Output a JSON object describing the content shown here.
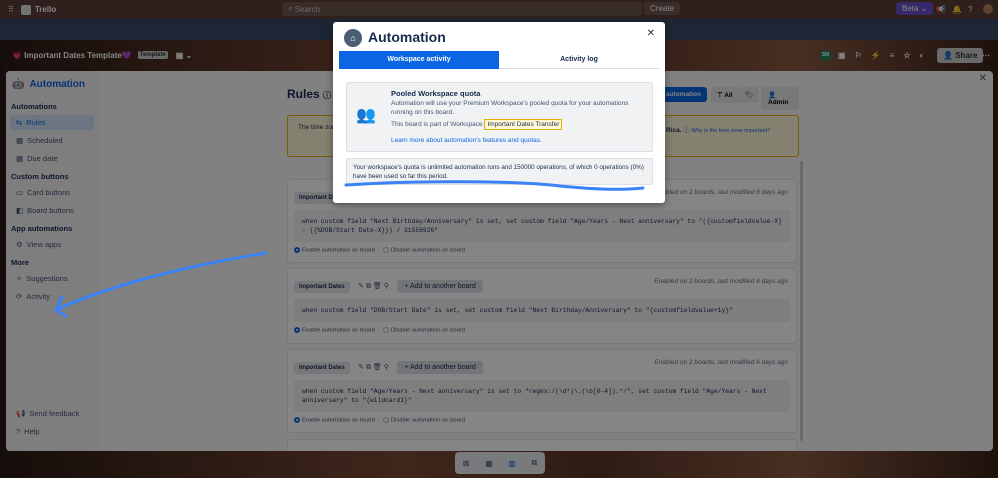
{
  "topbar": {
    "app_name": "Trello",
    "search_placeholder": "Search",
    "create_label": "Create",
    "beta_label": "Beta"
  },
  "board": {
    "title": "💗 Important Dates Template💜",
    "template_badge": "Template",
    "member_initials": "SM",
    "share_label": "Share"
  },
  "automation_panel": {
    "title": "Automation",
    "sidebar": {
      "sections": [
        {
          "heading": "Automations",
          "items": [
            "Rules",
            "Scheduled",
            "Due date"
          ]
        },
        {
          "heading": "Custom buttons",
          "items": [
            "Card buttons",
            "Board buttons"
          ]
        },
        {
          "heading": "App automations",
          "items": [
            "View apps"
          ]
        },
        {
          "heading": "More",
          "items": [
            "Suggestions",
            "Activity"
          ]
        }
      ],
      "footer": [
        "Send feedback",
        "Help"
      ]
    },
    "rules_title": "Rules",
    "toolbar": {
      "create_label": "automation",
      "filter_label": "All",
      "admin_label": "Admin"
    },
    "timezone": {
      "text_start": "The time zone",
      "text_end": "Rica.",
      "link": "Why is the time zone important?"
    },
    "rules": [
      {
        "tag": "Important Dates",
        "meta": "Enabled on 2 boards, last modified 6 days ago",
        "code": "when custom field \"Next Birthday/Anniversary\" is set, set custom field \"Age/Years - Next anniversary\" to \"({customfieldvalue-X} - {{%DOB/Start Date-X}}) / 31556926\""
      },
      {
        "tag": "Important Dates",
        "meta": "Enabled on 2 boards, last modified 6 days ago",
        "code": "when custom field \"DOB/Start Date\" is set, set custom field \"Next Birthday/Anniversary\" to \"{customfieldvalue+1y}\""
      },
      {
        "tag": "Important Dates",
        "meta": "Enabled on 2 boards, last modified 6 days ago",
        "code": "when custom field \"Age/Years - Next anniversary\" is set to \"regex:/(\\d*)\\.(\\b[0-4]).*/\", set custom field \"Age/Years - Next anniversary\" to \"{wildcard1}\""
      }
    ],
    "add_label": "Add to another board",
    "enable_label": "Enable automation on board",
    "disable_label": "Disable automation on board"
  },
  "modal": {
    "title": "Automation",
    "tabs": [
      "Workspace activity",
      "Activity log"
    ],
    "quota_heading": "Pooled Workspace quota",
    "quota_desc": "Automation will use your Premium Workspace's pooled quota for your automations running on this board.",
    "workspace_prefix": "This board is part of Workspace",
    "workspace_name": "Important Dates Transfer",
    "learn_more": "Learn more about automation's features and quotas.",
    "usage": "Your workspace's quota is unlimited automation runs and 150000 operations, of which 0 operations (0%) have been used so far this period."
  },
  "colors": {
    "accent": "#0c66e4",
    "annotation": "#3b82f6"
  }
}
